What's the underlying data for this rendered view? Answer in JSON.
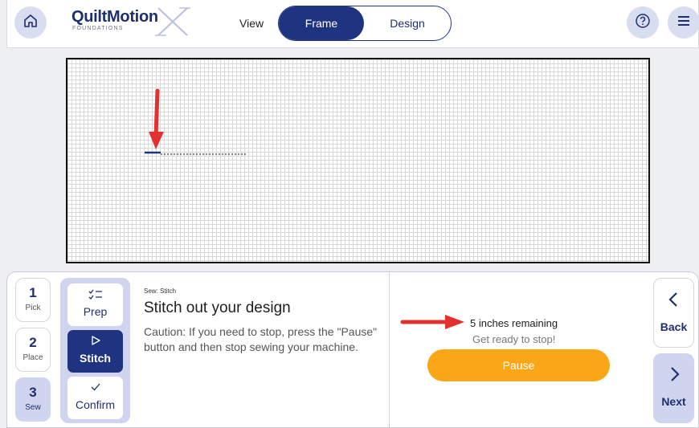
{
  "header": {
    "logo_main": "QuiltMotion",
    "logo_sub": "FOUNDATIONS",
    "view_label": "View",
    "tabs": [
      {
        "label": "Frame",
        "selected": true
      },
      {
        "label": "Design",
        "selected": false
      }
    ],
    "icons": {
      "home": "home-icon",
      "help": "help-icon",
      "menu": "hamburger-menu-icon"
    }
  },
  "colors": {
    "brand": "#1f3480",
    "accent_light": "#cfd5ee",
    "pause": "#fba616",
    "annotation": "#e53030"
  },
  "steps": [
    {
      "number": "1",
      "label": "Pick",
      "active": false
    },
    {
      "number": "2",
      "label": "Place",
      "active": false
    },
    {
      "number": "3",
      "label": "Sew",
      "active": true
    }
  ],
  "substeps": [
    {
      "label": "Prep",
      "icon": "checklist-icon",
      "active": false
    },
    {
      "label": "Stitch",
      "icon": "play-outline-icon",
      "active": true
    },
    {
      "label": "Confirm",
      "icon": "checkmark-icon",
      "active": false
    }
  ],
  "instructions": {
    "small_label": "Sew: Stitch",
    "title": "Stitch out your design",
    "body": "Caution: If you need to stop, press the \"Pause\" button and then stop sewing your machine."
  },
  "status": {
    "remaining": "5 inches remaining",
    "prompt": "Get ready to stop!",
    "pause_label": "Pause"
  },
  "nav": {
    "back_label": "Back",
    "next_label": "Next"
  }
}
